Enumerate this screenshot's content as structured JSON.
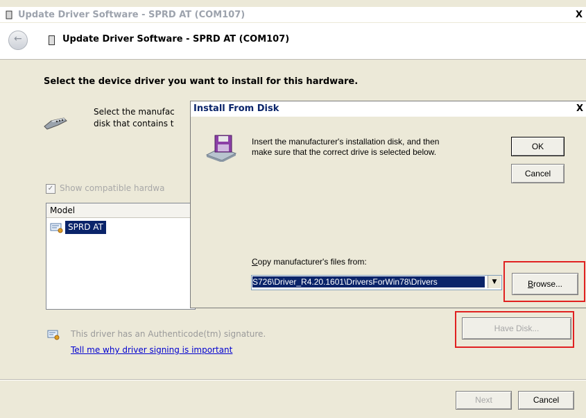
{
  "window": {
    "title": "Update Driver Software - SPRD AT (COM107)",
    "close_glyph": "X",
    "header_title": "Update Driver Software - SPRD AT (COM107)",
    "back_glyph": "←"
  },
  "main": {
    "heading": "Select the device driver you want to install for this hardware.",
    "desc_line1": "Select the manufac",
    "desc_line2": "disk that contains t",
    "show_compatible_label": "Show compatible hardwa",
    "show_compatible_checked": true,
    "checkmark_glyph": "✓",
    "model_column_header": "Model",
    "model_items": [
      "SPRD AT"
    ],
    "signature_text": "This driver has an Authenticode(tm) signature.",
    "signature_link": "Tell me why driver signing is important",
    "have_disk_label": "Have Disk...",
    "next_label": "Next",
    "cancel_label": "Cancel"
  },
  "dialog": {
    "title": "Install From Disk",
    "close_glyph": "X",
    "message_line1": "Insert the manufacturer's installation disk, and then",
    "message_line2": "make sure that the correct drive is selected below.",
    "ok_label": "OK",
    "cancel_label": "Cancel",
    "copy_label_accel": "C",
    "copy_label_rest": "opy manufacturer's files from:",
    "path_value": "S726\\Driver_R4.20.1601\\DriversForWin78\\Drivers",
    "dropdown_glyph": "▼",
    "browse_accel": "B",
    "browse_rest": "rowse..."
  },
  "icons": {
    "back": "back-arrow-icon",
    "device": "serial-device-icon",
    "floppy": "floppy-disk-icon",
    "certificate": "certificate-icon"
  },
  "colors": {
    "highlight_box": "#e02020",
    "selection": "#0a246a",
    "link": "#0000d0",
    "dialog_bg": "#ece9d8"
  }
}
